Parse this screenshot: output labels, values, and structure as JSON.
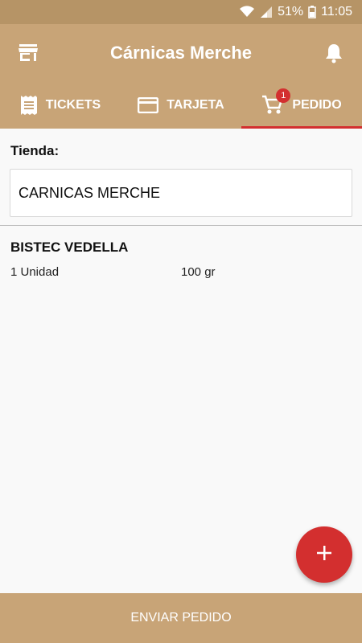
{
  "status_bar": {
    "battery": "51%",
    "time": "11:05"
  },
  "app_bar": {
    "title": "Cárnicas Merche"
  },
  "tabs": [
    {
      "label": "TICKETS",
      "icon": "receipt-icon"
    },
    {
      "label": "TARJETA",
      "icon": "card-icon"
    },
    {
      "label": "PEDIDO",
      "icon": "cart-icon",
      "badge": "1",
      "active": true
    }
  ],
  "store": {
    "label": "Tienda:",
    "value": "CARNICAS MERCHE"
  },
  "order_items": [
    {
      "name": "BISTEC VEDELLA",
      "quantity": "1 Unidad",
      "weight": "100 gr"
    }
  ],
  "bottom_button": {
    "label": "ENVIAR PEDIDO"
  },
  "colors": {
    "primary": "#c8a477",
    "status_bar": "#b69466",
    "accent": "#d32f2f"
  }
}
